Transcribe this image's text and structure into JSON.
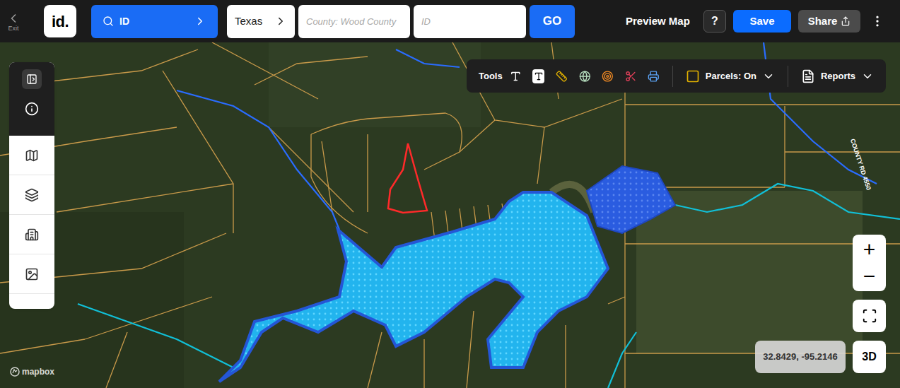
{
  "header": {
    "exit": "Exit",
    "logo": "id.",
    "search_mode": "ID",
    "state": "Texas",
    "county_field": {
      "placeholder": "County: Wood County",
      "value": ""
    },
    "id_field": {
      "placeholder": "ID",
      "value": ""
    },
    "go": "GO",
    "preview": "Preview Map",
    "help": "?",
    "save": "Save",
    "share": "Share"
  },
  "toolbar": {
    "label": "Tools",
    "parcels": "Parcels: On",
    "reports": "Reports"
  },
  "map": {
    "road_label": "COUNTY RD 4550",
    "coordinates": "32.8429, -95.2146",
    "attribution": "mapbox",
    "zoom_in": "+",
    "zoom_out": "−",
    "view_3d": "3D"
  }
}
